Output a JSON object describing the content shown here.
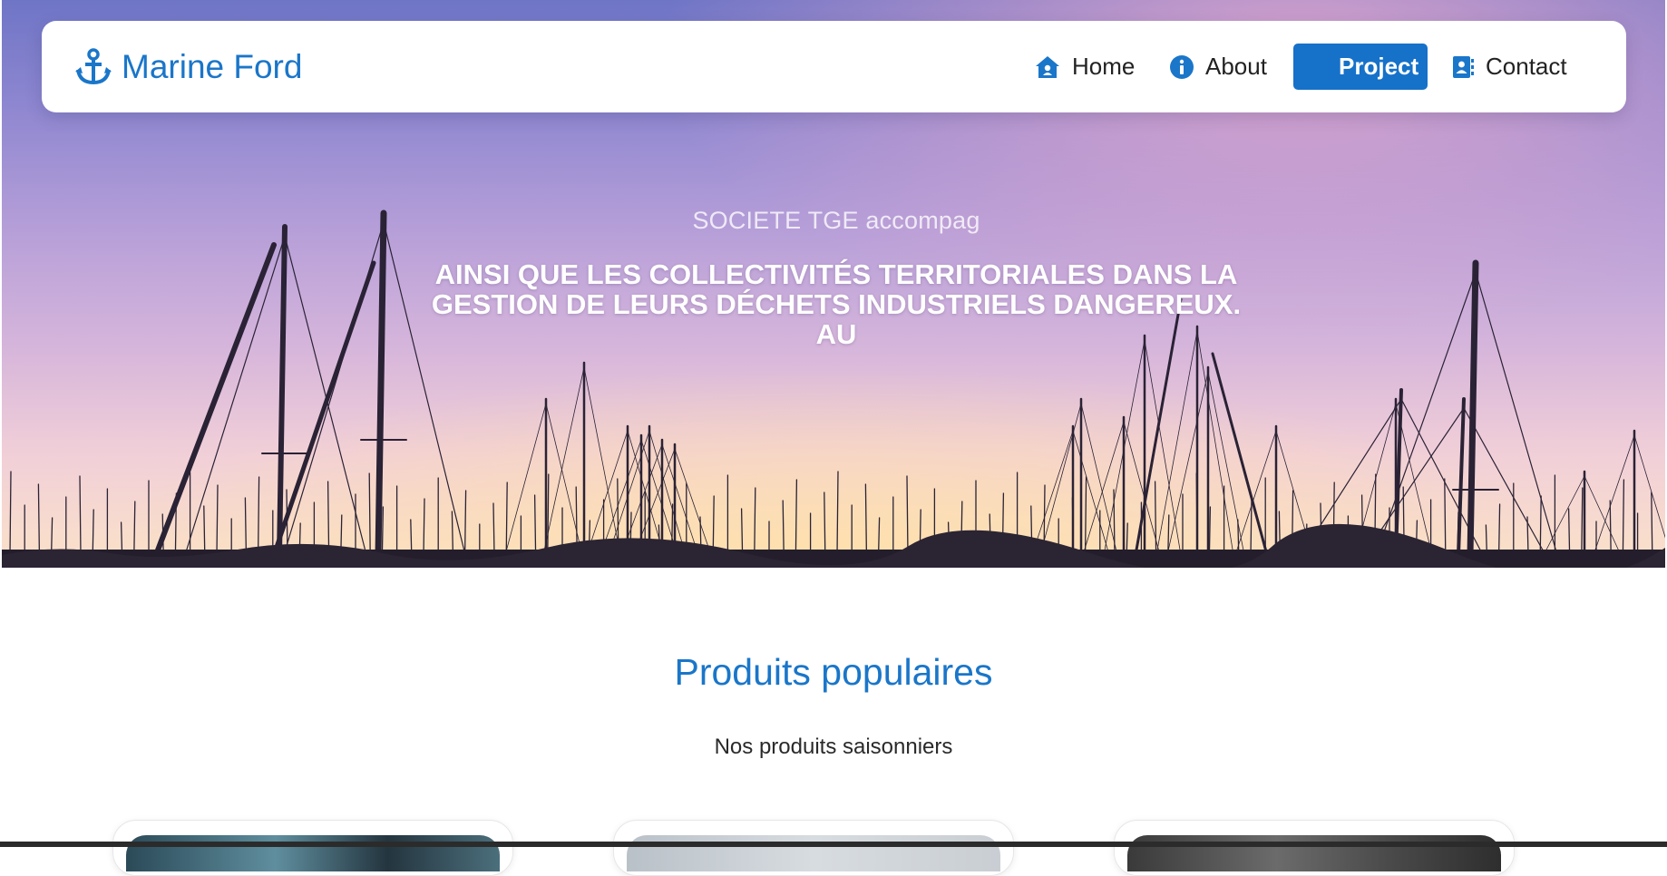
{
  "brand": {
    "name": "Marine Ford",
    "icon": "anchor-icon"
  },
  "nav": {
    "items": [
      {
        "label": "Home",
        "icon": "home-icon",
        "active": false
      },
      {
        "label": "About",
        "icon": "info-icon",
        "active": false
      },
      {
        "label": "Project",
        "icon": "",
        "active": true
      },
      {
        "label": "Contact",
        "icon": "contact-book-icon",
        "active": false
      }
    ]
  },
  "hero": {
    "kicker": "SOCIETE TGE accompag",
    "headline_lines": [
      "AINSI QUE LES COLLECTIVITÉS TERRITORIALES DANS LA",
      "GESTION DE LEURS DÉCHETS INDUSTRIELS DANGEREUX.",
      "AU"
    ]
  },
  "products": {
    "title": "Produits populaires",
    "subtitle": "Nos produits saisonniers"
  },
  "colors": {
    "accent": "#1a76c9",
    "active_nav_bg": "#1671c9",
    "text_dark": "#222222"
  }
}
